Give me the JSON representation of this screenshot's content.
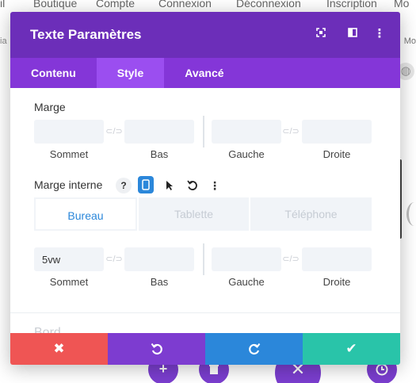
{
  "background": {
    "nav": [
      "il",
      "Boutique",
      "Compte",
      "Connexion",
      "Déconnexion",
      "Inscription",
      "Mo"
    ],
    "left_label": "ia",
    "right_label": "Mo"
  },
  "modal": {
    "title": "Texte Paramètres",
    "header_icons": [
      "expand-icon",
      "columns-icon",
      "more-icon"
    ],
    "tabs": [
      {
        "label": "Contenu",
        "active": false
      },
      {
        "label": "Style",
        "active": true
      },
      {
        "label": "Avancé",
        "active": false
      }
    ],
    "marge": {
      "label": "Marge",
      "fields": [
        {
          "value": "",
          "caption": "Sommet"
        },
        {
          "value": "",
          "caption": "Bas"
        },
        {
          "value": "",
          "caption": "Gauche"
        },
        {
          "value": "",
          "caption": "Droite"
        }
      ]
    },
    "marge_interne": {
      "label": "Marge interne",
      "tool_icons": [
        "help-icon",
        "phone-icon",
        "cursor-icon",
        "reset-icon",
        "more-icon"
      ],
      "device_tabs": [
        {
          "label": "Bureau",
          "active": true
        },
        {
          "label": "Tablette",
          "active": false
        },
        {
          "label": "Téléphone",
          "active": false
        }
      ],
      "fields": [
        {
          "value": "5vw",
          "caption": "Sommet"
        },
        {
          "value": "",
          "caption": "Bas"
        },
        {
          "value": "",
          "caption": "Gauche"
        },
        {
          "value": "",
          "caption": "Droite"
        }
      ]
    },
    "next_section_label": "Bord",
    "footer": [
      "close-icon",
      "undo-icon",
      "redo-icon",
      "check-icon"
    ]
  },
  "colors": {
    "header": "#6c2eb9",
    "tabs": "#8436d8",
    "active_tab": "#9b4ef0",
    "accent": "#2b87da",
    "cancel": "#ef5554",
    "undo": "#7d3cd0",
    "redo": "#2b87da",
    "save": "#29c4a9"
  }
}
